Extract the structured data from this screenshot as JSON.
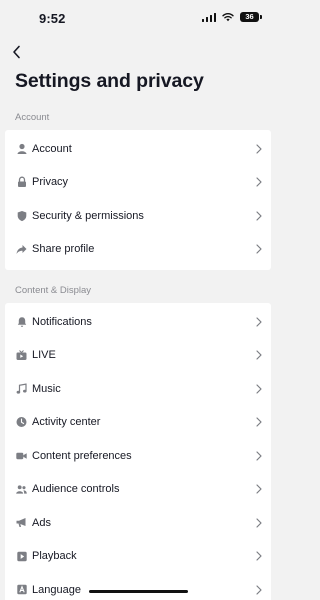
{
  "status_bar": {
    "time": "9:52",
    "battery": "36"
  },
  "header": {
    "title": "Settings and privacy"
  },
  "sections": [
    {
      "label": "Account",
      "items": [
        {
          "label": "Account",
          "icon": "person-icon"
        },
        {
          "label": "Privacy",
          "icon": "lock-icon"
        },
        {
          "label": "Security & permissions",
          "icon": "shield-icon"
        },
        {
          "label": "Share profile",
          "icon": "share-arrow-icon"
        }
      ]
    },
    {
      "label": "Content & Display",
      "items": [
        {
          "label": "Notifications",
          "icon": "bell-icon"
        },
        {
          "label": "LIVE",
          "icon": "live-tv-icon"
        },
        {
          "label": "Music",
          "icon": "music-note-icon"
        },
        {
          "label": "Activity center",
          "icon": "clock-icon"
        },
        {
          "label": "Content preferences",
          "icon": "video-camera-icon"
        },
        {
          "label": "Audience controls",
          "icon": "people-icon"
        },
        {
          "label": "Ads",
          "icon": "megaphone-icon"
        },
        {
          "label": "Playback",
          "icon": "play-icon"
        },
        {
          "label": "Language",
          "icon": "language-a-icon"
        }
      ]
    }
  ]
}
